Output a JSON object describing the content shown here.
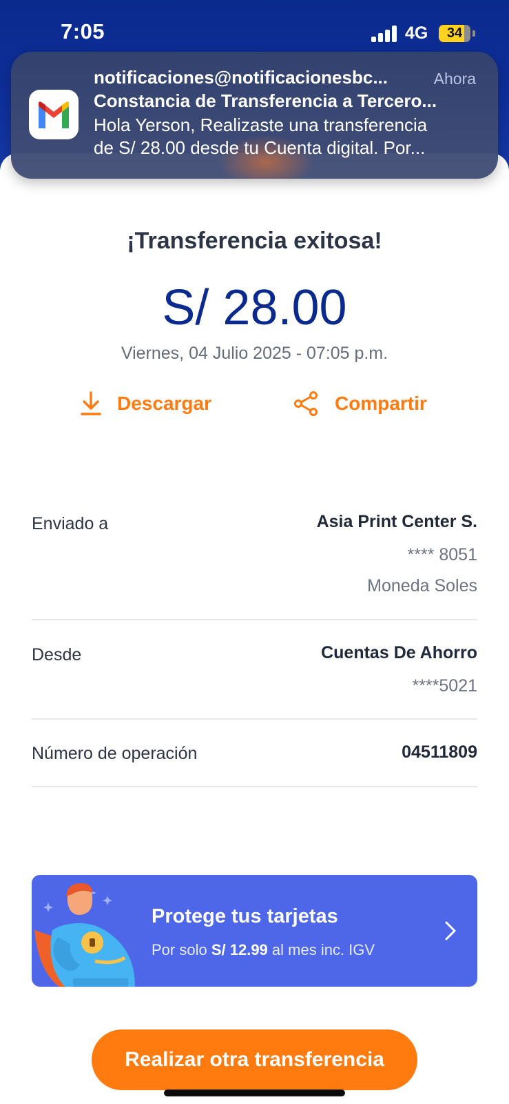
{
  "status_bar": {
    "time": "7:05",
    "network": "4G",
    "battery": "34"
  },
  "notification": {
    "app_icon": "gmail-icon",
    "sender": "notificaciones@notificacionesbc...",
    "time": "Ahora",
    "subject": "Constancia de Transferencia a Tercero...",
    "body_line1": "Hola Yerson, Realizaste una transferencia",
    "body_line2": "de S/ 28.00 desde tu Cuenta digital. Por..."
  },
  "receipt": {
    "title": "¡Transferencia exitosa!",
    "amount": "S/ 28.00",
    "datetime": "Viernes, 04 Julio 2025 - 07:05 p.m.",
    "download_label": "Descargar",
    "share_label": "Compartir"
  },
  "details": {
    "sent_to": {
      "label": "Enviado a",
      "name": "Asia Print Center S.",
      "account": "**** 8051",
      "currency": "Moneda Soles"
    },
    "from": {
      "label": "Desde",
      "account_type": "Cuentas De Ahorro",
      "account": "****5021"
    },
    "operation": {
      "label": "Número de operación",
      "number": "04511809"
    }
  },
  "banner": {
    "title": "Protege tus tarjetas",
    "sub_prefix": "Por solo",
    "sub_price": "S/ 12.99",
    "sub_suffix": "al mes inc. IGV"
  },
  "cta": {
    "label": "Realizar otra transferencia"
  },
  "colors": {
    "brand_blue": "#0b2a8e",
    "accent_orange": "#ff7a0f",
    "banner_blue": "#4e67e8"
  }
}
